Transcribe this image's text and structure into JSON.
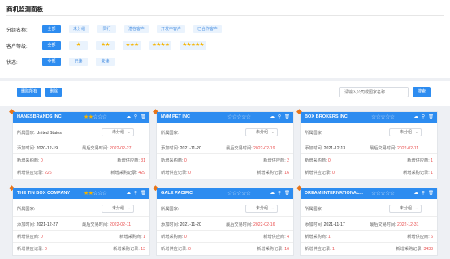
{
  "title": "商机监测面板",
  "filters": {
    "category": {
      "label": "分组名称:",
      "options": [
        "全部",
        "未分组",
        "同行",
        "潜在客户",
        "开发中客户",
        "已合作客户"
      ]
    },
    "grade": {
      "label": "客户等级:",
      "all": "全部",
      "options": [
        "★",
        "★★",
        "★★★",
        "★★★★",
        "★★★★★"
      ]
    },
    "status": {
      "label": "状态:",
      "options": [
        "全部",
        "已读",
        "未读"
      ]
    }
  },
  "toolbar": {
    "delete_all": "删除所有",
    "delete": "删除",
    "search_placeholder": "请输入公司或国家名称",
    "search": "搜索"
  },
  "labels": {
    "country": "所属国家:",
    "added": "添加时间:",
    "last_trade": "最后交易时间:",
    "new_buyers": "新增采购商:",
    "new_suppliers": "新增供应商:",
    "new_supply_records": "新增供应记录:",
    "new_purchase_records": "新增采购记录:"
  },
  "cards": [
    {
      "name": "HANESBRANDS INC",
      "rating": 2,
      "country": "United States",
      "group": "未分组",
      "added": "2020-12-19",
      "last_trade": "2022-02-27",
      "row3_label": "新增采购商:",
      "row3_value": "0",
      "row3r_label": "新增供应商:",
      "row3r_value": "31",
      "row4_label": "新增供应记录:",
      "row4_value": "226",
      "row4r_label": "新增采购记录:",
      "row4r_value": "429"
    },
    {
      "name": "NVM PET INC",
      "rating": 0,
      "country": "",
      "group": "未分组",
      "added": "2021-11-20",
      "last_trade": "2022-02-19",
      "row3_label": "新增采购商:",
      "row3_value": "0",
      "row3r_label": "新增供应商:",
      "row3r_value": "2",
      "row4_label": "新增供应记录:",
      "row4_value": "0",
      "row4r_label": "新增采购记录:",
      "row4r_value": "16"
    },
    {
      "name": "BOX BROKERS INC",
      "rating": 0,
      "country": "",
      "group": "未分组",
      "added": "2021-12-13",
      "last_trade": "2022-02-11",
      "row3_label": "新增采购商:",
      "row3_value": "0",
      "row3r_label": "新增供应商:",
      "row3r_value": "1",
      "row4_label": "新增供应记录:",
      "row4_value": "0",
      "row4r_label": "新增采购记录:",
      "row4r_value": "1"
    },
    {
      "name": "THE TIN BOX COMPANY",
      "rating": 2,
      "country": "",
      "group": "未分组",
      "added": "2021-12-27",
      "last_trade": "2022-02-11",
      "row3_label": "新增供应商:",
      "row3_value": "0",
      "row3r_label": "新增采购商:",
      "row3r_value": "1",
      "row4_label": "新增供应记录:",
      "row4_value": "0",
      "row4r_label": "新增采购记录:",
      "row4r_value": "13"
    },
    {
      "name": "GALE PACIFIC",
      "rating": 0,
      "country": "",
      "group": "未分组",
      "added": "2021-11-20",
      "last_trade": "2022-02-16",
      "row3_label": "新增采购商:",
      "row3_value": "0",
      "row3r_label": "新增供应商:",
      "row3r_value": "4",
      "row4_label": "新增供应记录:",
      "row4_value": "0",
      "row4r_label": "新增采购记录:",
      "row4r_value": "16"
    },
    {
      "name": "DREAM INTERNATIONAL...",
      "rating": 0,
      "country": "",
      "group": "未分组",
      "added": "2021-11-17",
      "last_trade": "2022-12-31",
      "row3_label": "新增采购商:",
      "row3_value": "1",
      "row3r_label": "新增供应商:",
      "row3r_value": "6",
      "row4_label": "新增供应记录:",
      "row4_value": "1",
      "row4r_label": "新增采购记录:",
      "row4r_value": "3433"
    }
  ],
  "colors": {
    "primary": "#2d8cf0",
    "star": "#f5b400",
    "alert": "#e94e4e",
    "corner": "#e8751a"
  }
}
